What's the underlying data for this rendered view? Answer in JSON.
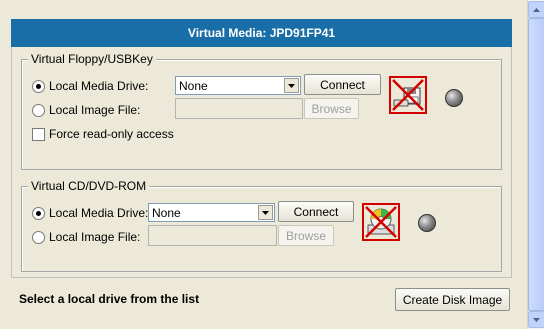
{
  "title": "Virtual Media: JPD91FP41",
  "floppy": {
    "legend": "Virtual Floppy/USBKey",
    "local_media_label": "Local Media Drive:",
    "local_media_value": "None",
    "local_image_label": "Local Image File:",
    "image_path_value": "",
    "connect_label": "Connect",
    "browse_label": "Browse",
    "readonly_label": "Force read-only access",
    "selected_option": "local-media-drive",
    "readonly_checked": false,
    "drive_icon": "floppy-drive-disconnected-icon"
  },
  "cdrom": {
    "legend": "Virtual CD/DVD-ROM",
    "local_media_label": "Local Media Drive:",
    "local_media_value": "None",
    "local_image_label": "Local Image File:",
    "image_path_value": "",
    "connect_label": "Connect",
    "browse_label": "Browse",
    "selected_option": "local-media-drive",
    "drive_icon": "cd-drive-disconnected-icon"
  },
  "status_text": "Select a local drive from the list",
  "create_disk_image_label": "Create Disk Image",
  "colors": {
    "title_bar": "#1a6ea8",
    "disconnected_border": "#d40000",
    "background": "#ece9d8"
  }
}
